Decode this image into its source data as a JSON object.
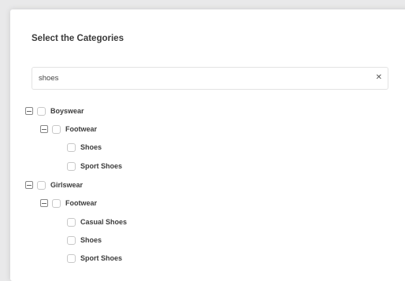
{
  "dialog": {
    "title": "Select the Categories"
  },
  "search": {
    "value": "shoes",
    "clear_icon": "close-icon"
  },
  "tree": {
    "boyswear": {
      "label": "Boyswear",
      "footwear": {
        "label": "Footwear",
        "items": [
          "Shoes",
          "Sport Shoes"
        ]
      }
    },
    "girlswear": {
      "label": "Girlswear",
      "footwear": {
        "label": "Footwear",
        "items": [
          "Casual Shoes",
          "Shoes",
          "Sport Shoes"
        ]
      }
    }
  }
}
